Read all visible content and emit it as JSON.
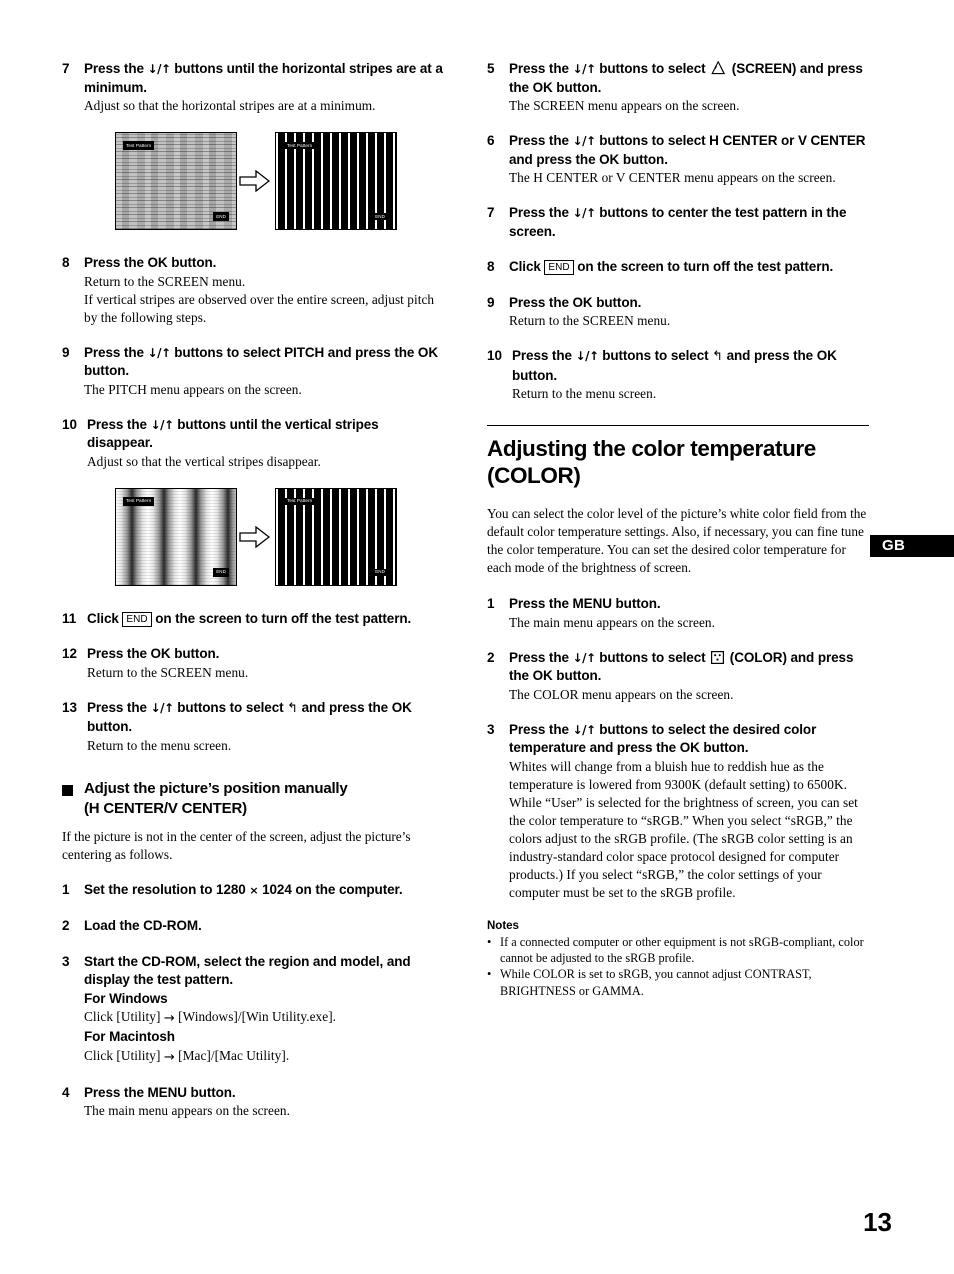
{
  "page": {
    "number": "13",
    "locale_tab": "GB"
  },
  "icons": {
    "down_up_arrows": "↓/↑",
    "screen_icon": "screen-icon",
    "color_icon": "color-icon",
    "return_arrow": "↰",
    "right_arrow": "→",
    "multiply": "×",
    "end_button": "END",
    "bullet": "•"
  },
  "left_column": {
    "steps": [
      {
        "num": "7",
        "title_parts": [
          "Press the ",
          "ARROWS",
          " buttons until the horizontal stripes are at a minimum."
        ],
        "title_plain": "Press the ↓/↑ buttons until the horizontal stripes are at a minimum.",
        "desc": "Adjust so that the horizontal stripes are at a minimum."
      },
      {
        "num": "8",
        "title_plain": "Press the OK button.",
        "desc": "Return to the SCREEN menu.",
        "desc2": "If vertical stripes are observed over the entire screen, adjust pitch by the following steps."
      },
      {
        "num": "9",
        "title_plain": "Press the ↓/↑ buttons to select PITCH and press the OK button.",
        "desc": "The PITCH menu appears on the screen."
      },
      {
        "num": "10",
        "title_plain": "Press the ↓/↑ buttons until the vertical stripes disappear.",
        "desc": "Adjust so that the vertical stripes disappear."
      },
      {
        "num": "11",
        "title_plain": "Click END on the screen to turn off the test pattern.",
        "desc": ""
      },
      {
        "num": "12",
        "title_plain": "Press the OK button.",
        "desc": "Return to the SCREEN menu."
      },
      {
        "num": "13",
        "title_plain": "Press the ↓/↑ buttons to select ↰ and press the OK button.",
        "desc": "Return to the menu screen."
      }
    ],
    "figure_1": {
      "panel_before_label_test": "Test Pattern",
      "panel_before_label_end": "END",
      "panel_after_label_test": "Test Pattern",
      "panel_after_label_end": "END"
    },
    "figure_2": {
      "panel_before_label_test": "Test Pattern",
      "panel_before_label_end": "END",
      "panel_after_label_test": "Test Pattern",
      "panel_after_label_end": "END"
    },
    "subsection": {
      "heading_line1": "Adjust the picture’s position manually",
      "heading_line2": "(H CENTER/V CENTER)",
      "lead": "If the picture is not in the center of the screen, adjust the picture’s centering as follows."
    },
    "subsection_steps": [
      {
        "num": "1",
        "title_pre": "Set the resolution to 1280 ",
        "title_post": " 1024 on the computer.",
        "desc": ""
      },
      {
        "num": "2",
        "title_plain": "Load the CD-ROM.",
        "desc": ""
      },
      {
        "num": "3",
        "title_plain": "Start the CD-ROM, select the region and model, and display the test pattern.",
        "sub_windows_label": "For Windows",
        "sub_windows_desc_pre": "Click [Utility] ",
        "sub_windows_desc_post": " [Windows]/[Win Utility.exe].",
        "sub_mac_label": "For Macintosh",
        "sub_mac_desc_pre": "Click [Utility] ",
        "sub_mac_desc_post": " [Mac]/[Mac Utility]."
      },
      {
        "num": "4",
        "title_plain": "Press the MENU button.",
        "desc": "The main menu appears on the screen."
      }
    ]
  },
  "right_column": {
    "steps": [
      {
        "num": "5",
        "title_pre": "Press the ↓/↑ buttons to select ",
        "title_post": " (SCREEN) and press the OK button.",
        "desc": "The SCREEN menu appears on the screen."
      },
      {
        "num": "6",
        "title_plain": "Press the ↓/↑ buttons to select H CENTER or V CENTER and press the OK button.",
        "desc": "The H CENTER or V CENTER menu appears on the screen."
      },
      {
        "num": "7",
        "title_plain": "Press the ↓/↑ buttons to center the test pattern in the screen.",
        "desc": ""
      },
      {
        "num": "8",
        "title_plain": "Click END on the screen to turn off the test pattern.",
        "desc": ""
      },
      {
        "num": "9",
        "title_plain": "Press the OK button.",
        "desc": "Return to the SCREEN menu."
      },
      {
        "num": "10",
        "title_plain": "Press the ↓/↑ buttons to select ↰ and press the OK button.",
        "desc": "Return to the menu screen."
      }
    ],
    "section": {
      "heading_line1": "Adjusting the color temperature",
      "heading_line2": "(COLOR)",
      "intro": "You can select the color level of the picture’s white color field from the default color temperature settings. Also, if necessary, you can fine tune the color temperature. You can set the desired color temperature for each mode of the brightness of screen."
    },
    "section_steps": [
      {
        "num": "1",
        "title_plain": "Press the MENU button.",
        "desc": "The main menu appears on the screen."
      },
      {
        "num": "2",
        "title_pre": "Press the ↓/↑ buttons to select ",
        "title_post": " (COLOR) and press the OK button.",
        "desc": "The COLOR menu appears on the screen."
      },
      {
        "num": "3",
        "title_plain": "Press the ↓/↑ buttons to select the desired color temperature and press the OK button.",
        "desc": "Whites will change from a bluish hue to reddish hue as the temperature is lowered from 9300K (default setting) to 6500K. While “User” is selected for the brightness of screen, you can set the color temperature to “sRGB.” When you select “sRGB,” the colors adjust to the sRGB profile. (The sRGB color setting is an industry-standard color space protocol designed for computer products.) If you select “sRGB,” the color settings of your computer must be set to the sRGB profile."
      }
    ],
    "notes": {
      "title": "Notes",
      "items": [
        "If a connected computer or other equipment is not sRGB-compliant, color cannot be adjusted to the sRGB profile.",
        "While COLOR is set to sRGB, you cannot adjust CONTRAST, BRIGHTNESS or GAMMA."
      ]
    }
  }
}
